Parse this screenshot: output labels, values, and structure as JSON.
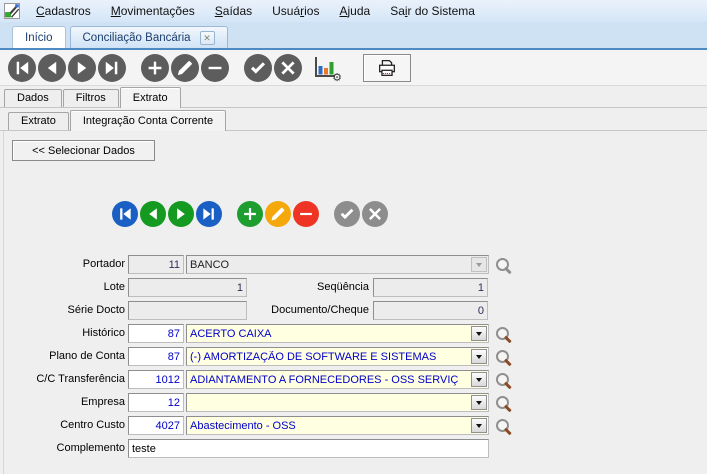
{
  "colors": {
    "tab_accent": "#4d8ac2",
    "combo_bg": "#ffffe1",
    "value_blue": "#0000cc",
    "toolbar_circle": "#5d5d5d"
  },
  "menubar": {
    "items": [
      {
        "name": "cadastros",
        "label": "Cadastros",
        "accel": 0
      },
      {
        "name": "movimentacoes",
        "label": "Movimentações",
        "accel": 0
      },
      {
        "name": "saidas",
        "label": "Saídas",
        "accel": 0
      },
      {
        "name": "usuarios",
        "label": "Usuários",
        "accel": 4
      },
      {
        "name": "ajuda",
        "label": "Ajuda",
        "accel": 0
      },
      {
        "name": "sair-do-sistema",
        "label": "Sair do Sistema",
        "accel": 2
      }
    ]
  },
  "window_tabs": {
    "inicio": "Início",
    "conciliacao": "Conciliação Bancária",
    "close_icon": "close-icon"
  },
  "toolbar": {
    "buttons": [
      {
        "name": "first-record-button",
        "icon": "first",
        "color": "#5d5d5d"
      },
      {
        "name": "previous-record-button",
        "icon": "prev",
        "color": "#5d5d5d"
      },
      {
        "name": "next-record-button",
        "icon": "next",
        "color": "#5d5d5d"
      },
      {
        "name": "last-record-button",
        "icon": "last",
        "color": "#5d5d5d",
        "gap_after": true
      },
      {
        "name": "add-record-button",
        "icon": "add",
        "color": "#5d5d5d"
      },
      {
        "name": "edit-record-button",
        "icon": "edit",
        "color": "#5d5d5d"
      },
      {
        "name": "delete-record-button",
        "icon": "remove",
        "color": "#5d5d5d",
        "gap_after": true
      },
      {
        "name": "confirm-button",
        "icon": "confirm",
        "color": "#5d5d5d"
      },
      {
        "name": "cancel-button",
        "icon": "cancel",
        "color": "#5d5d5d"
      }
    ],
    "chart_button_icon": "bar-chart-settings-icon",
    "print_button_icon": "printer-icon"
  },
  "main_tabs": {
    "dados": "Dados",
    "filtros": "Filtros",
    "extrato": "Extrato",
    "selected": "Extrato"
  },
  "sub_tabs": {
    "extrato": "Extrato",
    "integracao": "Integração Conta Corrente",
    "selected": "Integração Conta Corrente"
  },
  "selecionar_button": {
    "label": "<< Selecionar Dados"
  },
  "record_nav": {
    "buttons": [
      {
        "name": "first-record-button",
        "icon": "first",
        "color": "#1a5fc4"
      },
      {
        "name": "previous-record-button",
        "icon": "prev",
        "color": "#149a21"
      },
      {
        "name": "next-record-button",
        "icon": "next",
        "color": "#149a21"
      },
      {
        "name": "last-record-button",
        "icon": "last",
        "color": "#1a5fc4",
        "gap_after": true
      },
      {
        "name": "add-record-button",
        "icon": "add",
        "color": "#1e9e2e"
      },
      {
        "name": "edit-record-button",
        "icon": "edit",
        "color": "#f4a80b"
      },
      {
        "name": "delete-record-button",
        "icon": "remove",
        "color": "#ee3424",
        "gap_after": true
      },
      {
        "name": "confirm-button",
        "icon": "confirm",
        "color": "#8d8d8d"
      },
      {
        "name": "cancel-button",
        "icon": "cancel",
        "color": "#8d8d8d"
      }
    ]
  },
  "form": {
    "portador": {
      "label": "Portador",
      "code": "11",
      "value": "BANCO"
    },
    "lote": {
      "label": "Lote",
      "value": "1"
    },
    "sequencia": {
      "label": "Seqüência",
      "value": "1"
    },
    "serie_docto": {
      "label": "Série Docto",
      "value": ""
    },
    "documento_cheque": {
      "label": "Documento/Cheque",
      "value": "0"
    },
    "historico": {
      "label": "Histórico",
      "code": "87",
      "value": "ACERTO CAIXA"
    },
    "plano_conta": {
      "label": "Plano de Conta",
      "code": "87",
      "value": "(-) AMORTIZAÇÃO DE SOFTWARE E SISTEMAS"
    },
    "cc_transferencia": {
      "label": "C/C Transferência",
      "code": "1012",
      "value": "ADIANTAMENTO A FORNECEDORES - OSS SERVIÇ"
    },
    "empresa": {
      "label": "Empresa",
      "code": "12",
      "value": ""
    },
    "centro_custo": {
      "label": "Centro Custo",
      "code": "4027",
      "value": "Abastecimento - OSS"
    },
    "complemento": {
      "label": "Complemento",
      "value": "teste"
    }
  }
}
